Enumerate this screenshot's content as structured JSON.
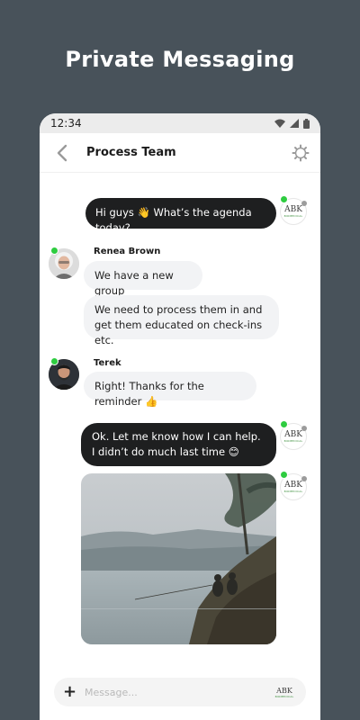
{
  "headline": "Private Messaging",
  "status_bar": {
    "time": "12:34"
  },
  "header": {
    "title": "Process Team"
  },
  "messages": [
    {
      "direction": "out",
      "text": "Hi guys 👋 What’s the agenda today?"
    },
    {
      "direction": "in",
      "sender": "Renea Brown",
      "text": "We have a new group"
    },
    {
      "direction": "in",
      "sender": "Renea Brown",
      "text": "We need to process them in and get them educated on check-ins etc."
    },
    {
      "direction": "in",
      "sender": "Terek",
      "text": "Right! Thanks for the reminder 👍"
    },
    {
      "direction": "out",
      "text": "Ok. Let me know how I can help. I didn’t do much last time 😊"
    },
    {
      "direction": "out",
      "type": "image",
      "description": "photo"
    }
  ],
  "logo": {
    "letters": "ABK",
    "tagline": "BIOMEDICAL"
  },
  "composer": {
    "placeholder": "Message..."
  },
  "colors": {
    "background": "#48525a",
    "online": "#2ecc40",
    "out_bubble": "#1e1f20",
    "in_bubble": "#f2f3f5"
  },
  "icons": [
    "chevron-left-icon",
    "settings-icon",
    "wifi-icon",
    "signal-icon",
    "battery-icon",
    "plus-icon"
  ]
}
